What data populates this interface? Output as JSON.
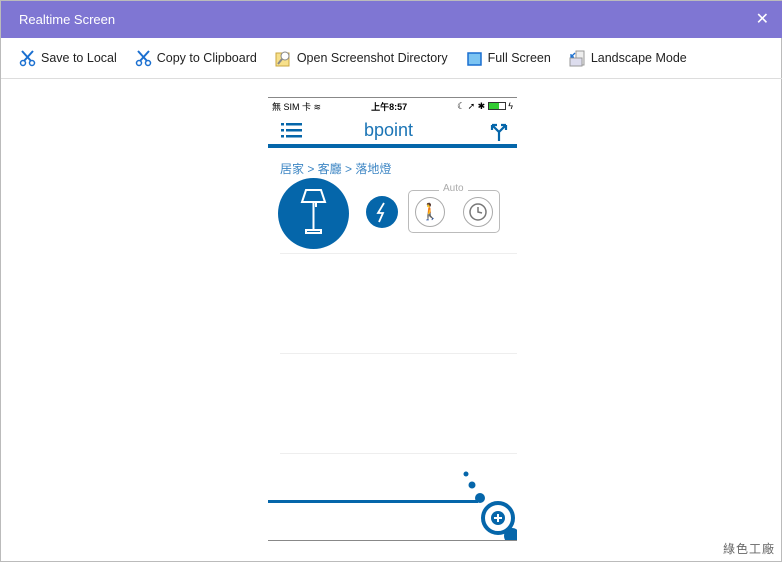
{
  "window": {
    "title": "Realtime Screen",
    "close_icon": "close-icon"
  },
  "toolbar": {
    "items": [
      {
        "label": "Save to Local",
        "icon": "scissors-icon"
      },
      {
        "label": "Copy to Clipboard",
        "icon": "scissors-icon"
      },
      {
        "label": "Open Screenshot Directory",
        "icon": "folder-search-icon"
      },
      {
        "label": "Full Screen",
        "icon": "fullscreen-icon"
      },
      {
        "label": "Landscape Mode",
        "icon": "landscape-icon"
      }
    ]
  },
  "phone": {
    "status": {
      "carrier": "無 SIM 卡",
      "time": "上午8:57"
    },
    "app_name": "bpoint",
    "breadcrumb": "居家 > 客廳 > 落地燈",
    "auto_label": "Auto"
  },
  "watermark": "綠色工廠",
  "colors": {
    "title_bar": "#7f76d3",
    "brand": "#0566aa"
  }
}
